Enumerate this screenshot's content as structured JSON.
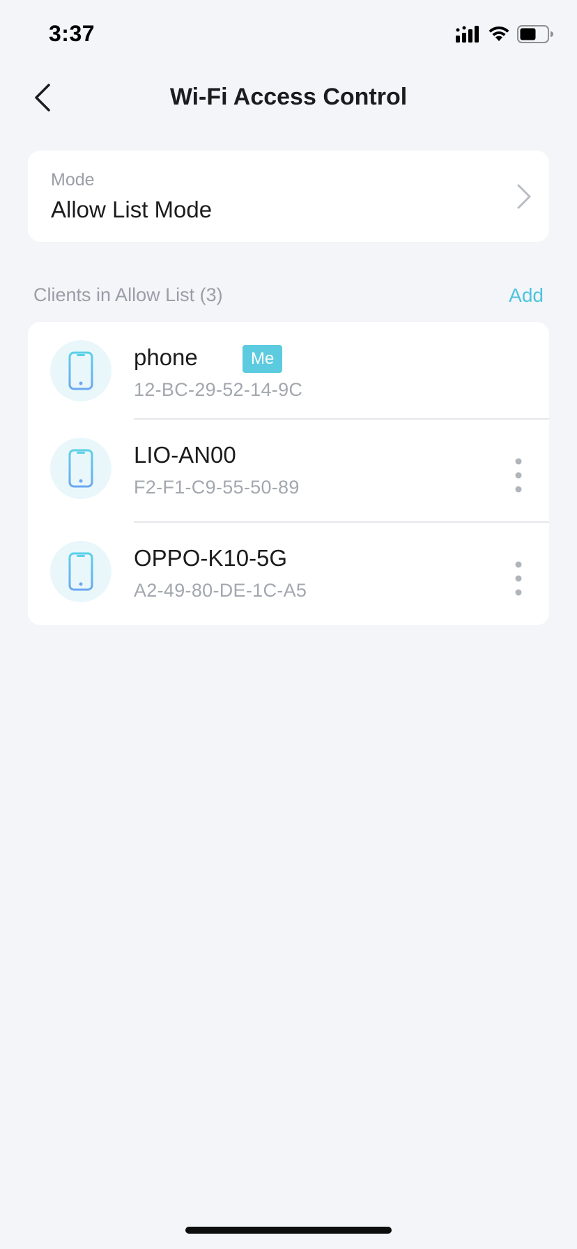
{
  "status_bar": {
    "time": "3:37",
    "icons": [
      "signal-icon",
      "wifi-icon",
      "battery-icon"
    ]
  },
  "nav": {
    "title": "Wi-Fi Access Control",
    "back_icon": "chevron-left-icon"
  },
  "mode": {
    "label": "Mode",
    "value": "Allow List Mode"
  },
  "clients_section": {
    "title": "Clients in Allow List (3)",
    "add_label": "Add"
  },
  "clients": [
    {
      "name": "phone",
      "mac": "12-BC-29-52-14-9C",
      "badge": "Me",
      "icon": "phone-icon"
    },
    {
      "name": "LIO-AN00",
      "mac": "F2-F1-C9-55-50-89",
      "icon": "phone-icon"
    },
    {
      "name": "OPPO-K10-5G",
      "mac": "A2-49-80-DE-1C-A5",
      "icon": "phone-icon"
    }
  ],
  "colors": {
    "accent": "#4cc4de",
    "badge_bg": "#5ccbe0",
    "background": "#f3f5f9",
    "card": "#ffffff",
    "secondary_text": "#9a9ea6"
  }
}
